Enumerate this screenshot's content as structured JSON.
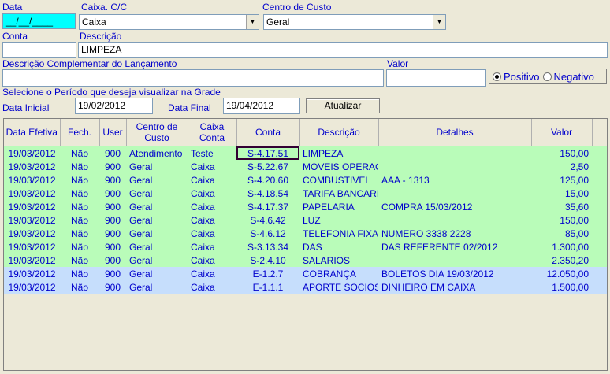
{
  "form": {
    "data_label": "Data",
    "data_value": "__/__/____",
    "caixa_label": "Caixa. C/C",
    "caixa_value": "Caixa",
    "centro_label": "Centro de Custo",
    "centro_value": "Geral",
    "conta_label": "Conta",
    "conta_value": "",
    "descricao_label": "Descrição",
    "descricao_value": "LIMPEZA",
    "desc_comp_label": "Descrição Complementar do Lançamento",
    "desc_comp_value": "",
    "valor_label": "Valor",
    "valor_value": "",
    "positivo_label": "Positivo",
    "negativo_label": "Negativo",
    "periodo_label": "Selecione o Período que deseja visualizar na Grade",
    "data_inicial_label": "Data Inicial",
    "data_inicial_value": "19/02/2012",
    "data_final_label": "Data Final",
    "data_final_value": "19/04/2012",
    "atualizar_label": "Atualizar"
  },
  "grid": {
    "headers": {
      "data": "Data Efetiva",
      "fech": "Fech.",
      "user": "User",
      "centro": "Centro de Custo",
      "caixa": "Caixa Conta",
      "conta": "Conta",
      "descricao": "Descrição",
      "detalhes": "Detalhes",
      "valor": "Valor"
    },
    "rows": [
      {
        "data": "19/03/2012",
        "fech": "Não",
        "user": "900",
        "centro": "Atendimento",
        "caixa": "Teste",
        "conta": "S-4.17.51",
        "descricao": "LIMPEZA",
        "detalhes": "",
        "valor": "150,00"
      },
      {
        "data": "19/03/2012",
        "fech": "Não",
        "user": "900",
        "centro": "Geral",
        "caixa": "Caixa",
        "conta": "S-5.22.67",
        "descricao": "MOVEIS OPERAC",
        "detalhes": "",
        "valor": "2,50"
      },
      {
        "data": "19/03/2012",
        "fech": "Não",
        "user": "900",
        "centro": "Geral",
        "caixa": "Caixa",
        "conta": "S-4.20.60",
        "descricao": "COMBUSTIVEL",
        "detalhes": "AAA - 1313",
        "valor": "125,00"
      },
      {
        "data": "19/03/2012",
        "fech": "Não",
        "user": "900",
        "centro": "Geral",
        "caixa": "Caixa",
        "conta": "S-4.18.54",
        "descricao": "TARIFA BANCARI/",
        "detalhes": "",
        "valor": "15,00"
      },
      {
        "data": "19/03/2012",
        "fech": "Não",
        "user": "900",
        "centro": "Geral",
        "caixa": "Caixa",
        "conta": "S-4.17.37",
        "descricao": "PAPELARIA",
        "detalhes": "COMPRA 15/03/2012",
        "valor": "35,60"
      },
      {
        "data": "19/03/2012",
        "fech": "Não",
        "user": "900",
        "centro": "Geral",
        "caixa": "Caixa",
        "conta": "S-4.6.42",
        "descricao": "LUZ",
        "detalhes": "",
        "valor": "150,00"
      },
      {
        "data": "19/03/2012",
        "fech": "Não",
        "user": "900",
        "centro": "Geral",
        "caixa": "Caixa",
        "conta": "S-4.6.12",
        "descricao": "TELEFONIA FIXA",
        "detalhes": "NUMERO 3338 2228",
        "valor": "85,00"
      },
      {
        "data": "19/03/2012",
        "fech": "Não",
        "user": "900",
        "centro": "Geral",
        "caixa": "Caixa",
        "conta": "S-3.13.34",
        "descricao": "DAS",
        "detalhes": "DAS REFERENTE 02/2012",
        "valor": "1.300,00"
      },
      {
        "data": "19/03/2012",
        "fech": "Não",
        "user": "900",
        "centro": "Geral",
        "caixa": "Caixa",
        "conta": "S-2.4.10",
        "descricao": "SALARIOS",
        "detalhes": "",
        "valor": "2.350,20"
      },
      {
        "data": "19/03/2012",
        "fech": "Não",
        "user": "900",
        "centro": "Geral",
        "caixa": "Caixa",
        "conta": "E-1.2.7",
        "descricao": "COBRANÇA",
        "detalhes": "BOLETOS DIA 19/03/2012",
        "valor": "12.050,00"
      },
      {
        "data": "19/03/2012",
        "fech": "Não",
        "user": "900",
        "centro": "Geral",
        "caixa": "Caixa",
        "conta": "E-1.1.1",
        "descricao": "APORTE SOCIOS",
        "detalhes": "DINHEIRO EM CAIXA",
        "valor": "1.500,00"
      }
    ]
  },
  "colors": {
    "green_row": "#B9FCB9",
    "blue_row": "#C6DEFC",
    "label": "#0000CC",
    "date_field": "#00FFFF"
  }
}
